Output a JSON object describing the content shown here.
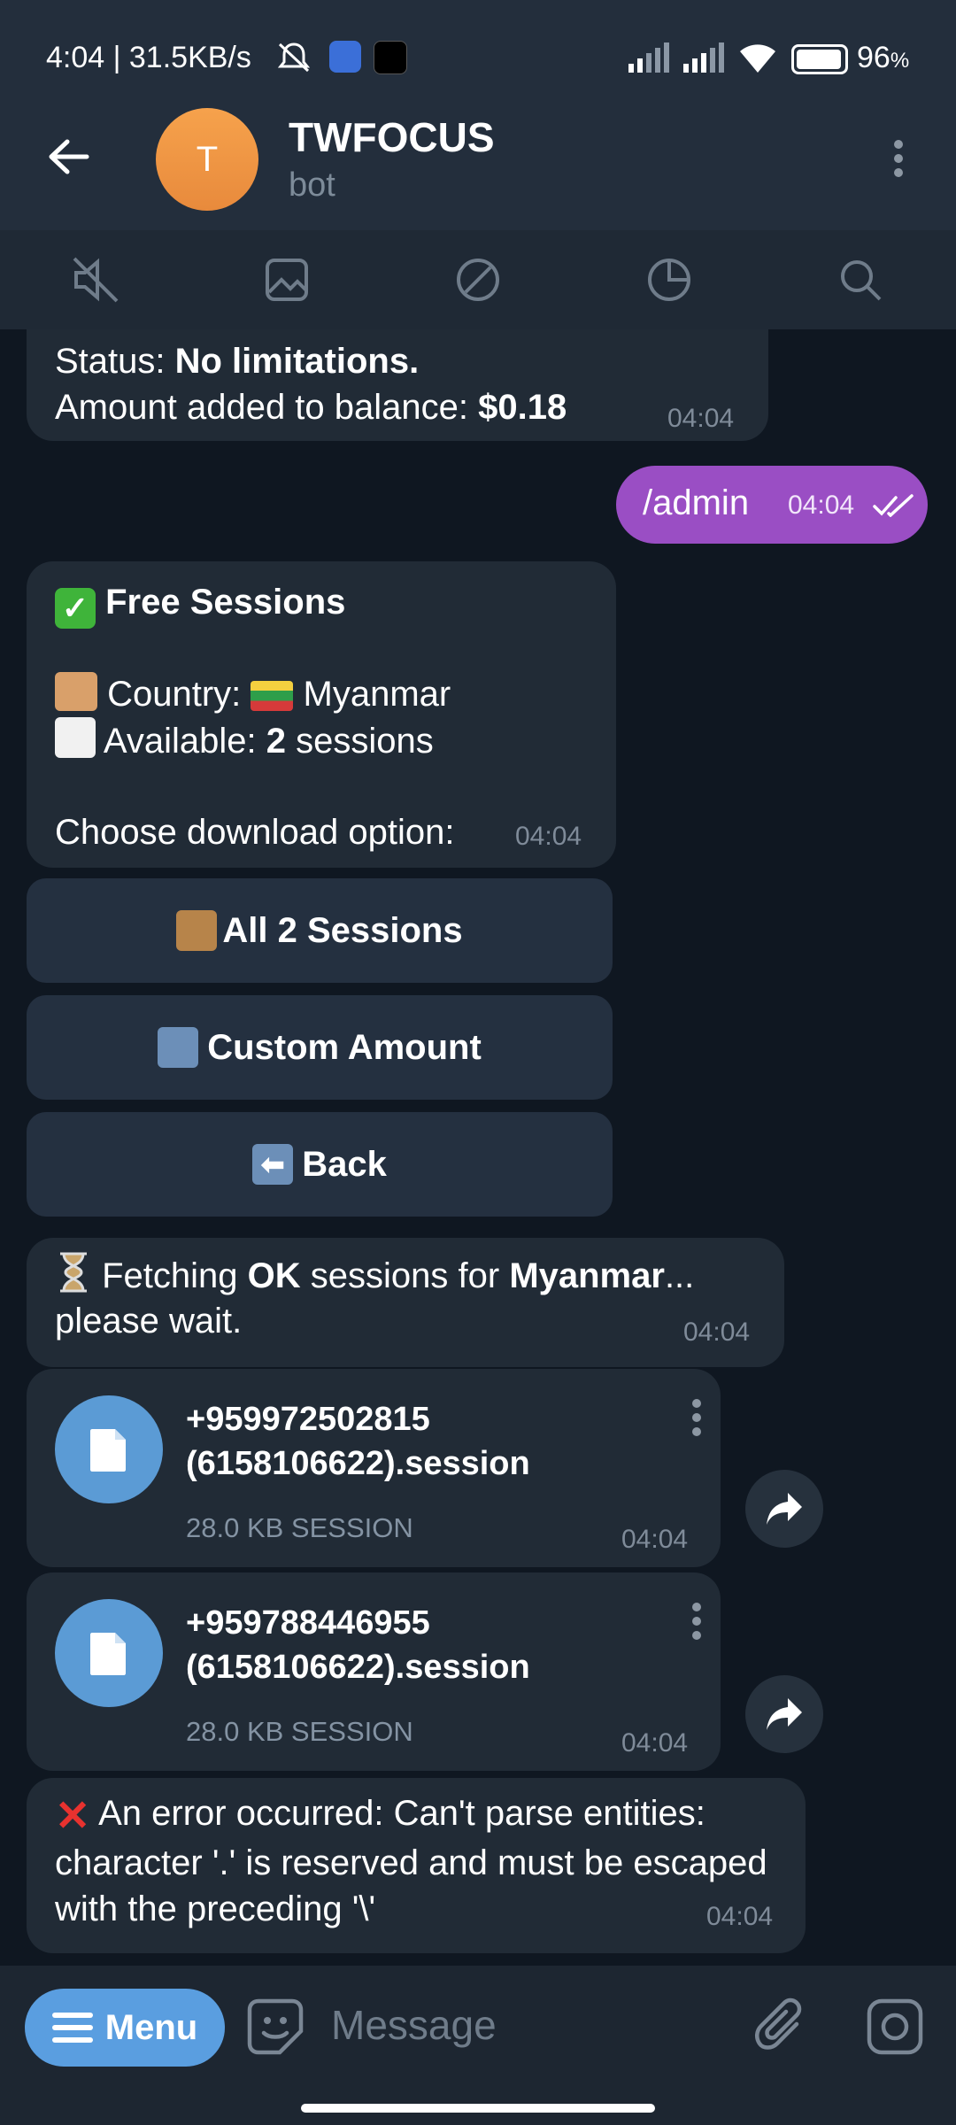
{
  "status_bar": {
    "time_speed": "4:04 | 31.5KB/s",
    "battery": "96",
    "battery_unit": "%"
  },
  "header": {
    "avatar_letter": "T",
    "title": "TWFOCUS",
    "subtitle": "bot"
  },
  "messages": {
    "status_label": "Status: ",
    "status_value": "No limitations.",
    "amount_label": "Amount added to balance: ",
    "amount_value": "$0.18",
    "m1_time": "04:04",
    "admin_text": "/admin",
    "admin_time": "04:04",
    "free_title": "Free Sessions",
    "country_label": "Country: ",
    "country_value": "Myanmar",
    "available_label": "Available: ",
    "available_count": "2",
    "available_suffix": " sessions",
    "choose_text": "Choose download option:",
    "m3_time": "04:04",
    "fetch_prefix": "Fetching ",
    "fetch_ok": "OK",
    "fetch_mid": " sessions for ",
    "fetch_country": "Myanmar",
    "fetch_suffix": "...",
    "fetch_line2": "please wait.",
    "fetch_time": "04:04",
    "error_text": "An error occurred: Can't parse entities: character '.' is reserved and must be escaped with the preceding '\\'",
    "error_time": "04:04"
  },
  "keyboard": {
    "all_sessions": "All 2 Sessions",
    "custom_amount": "Custom Amount",
    "back": "Back"
  },
  "files": [
    {
      "line1": "+959972502815",
      "line2": "(6158106622).session",
      "size": "28.0 KB SESSION",
      "time": "04:04"
    },
    {
      "line1": "+959788446955",
      "line2": "(6158106622).session",
      "size": "28.0 KB SESSION",
      "time": "04:04"
    }
  ],
  "input": {
    "menu_label": "Menu",
    "placeholder": "Message"
  },
  "colors": {
    "accent": "#5a9ee0",
    "outgoing_bubble": "#9a4ec4",
    "incoming_bubble": "#212b36",
    "background": "#0f1721"
  }
}
